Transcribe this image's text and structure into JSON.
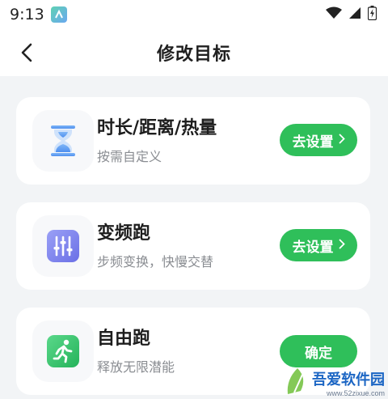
{
  "status_bar": {
    "time": "9:13",
    "app_icon": "app-notification-icon",
    "icons": [
      "wifi-icon",
      "signal-icon",
      "battery-icon"
    ]
  },
  "header": {
    "back_icon": "chevron-left-icon",
    "title": "修改目标"
  },
  "cards": [
    {
      "icon": "hourglass-icon",
      "icon_color": "#5b9cf2",
      "title": "时长/距离/热量",
      "subtitle": "按需自定义",
      "button_label": "去设置",
      "button_icon": "chevron-right-icon"
    },
    {
      "icon": "equalizer-icon",
      "icon_color": "#7b82ee",
      "title": "变频跑",
      "subtitle": "步频变换，快慢交替",
      "button_label": "去设置",
      "button_icon": "chevron-right-icon"
    },
    {
      "icon": "running-person-icon",
      "icon_color": "#34c46a",
      "title": "自由跑",
      "subtitle": "释放无限潜能",
      "button_label": "确定"
    }
  ],
  "accent_color": "#2fbf5a",
  "watermark": {
    "brand": "吾爱软件园",
    "url": "www.52zixue.com"
  }
}
